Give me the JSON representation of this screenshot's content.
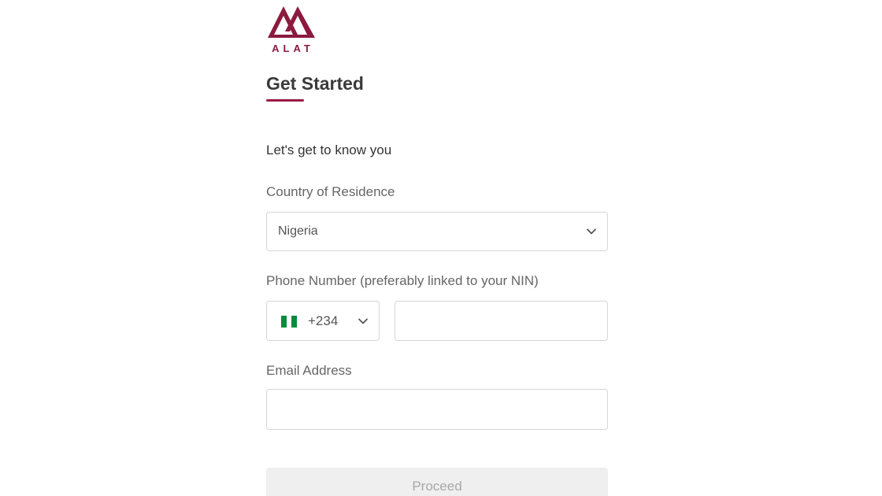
{
  "brand": {
    "logo_text": "ALAT",
    "color": "#9b1b47"
  },
  "header": {
    "title": "Get Started"
  },
  "form": {
    "intro": "Let's get to know you",
    "country": {
      "label": "Country of Residence",
      "value": "Nigeria",
      "icon": "chevron-down-icon"
    },
    "phone": {
      "label": "Phone Number (preferably linked to your NIN)",
      "dial_code": "+234",
      "flag": "nigeria-flag-icon",
      "value": ""
    },
    "email": {
      "label": "Email Address",
      "value": ""
    },
    "submit_label": "Proceed"
  },
  "colors": {
    "accent": "#9b1b47",
    "button_disabled_bg": "#efefef",
    "button_disabled_text": "#a8a8a8",
    "border": "#d6d6d6"
  }
}
